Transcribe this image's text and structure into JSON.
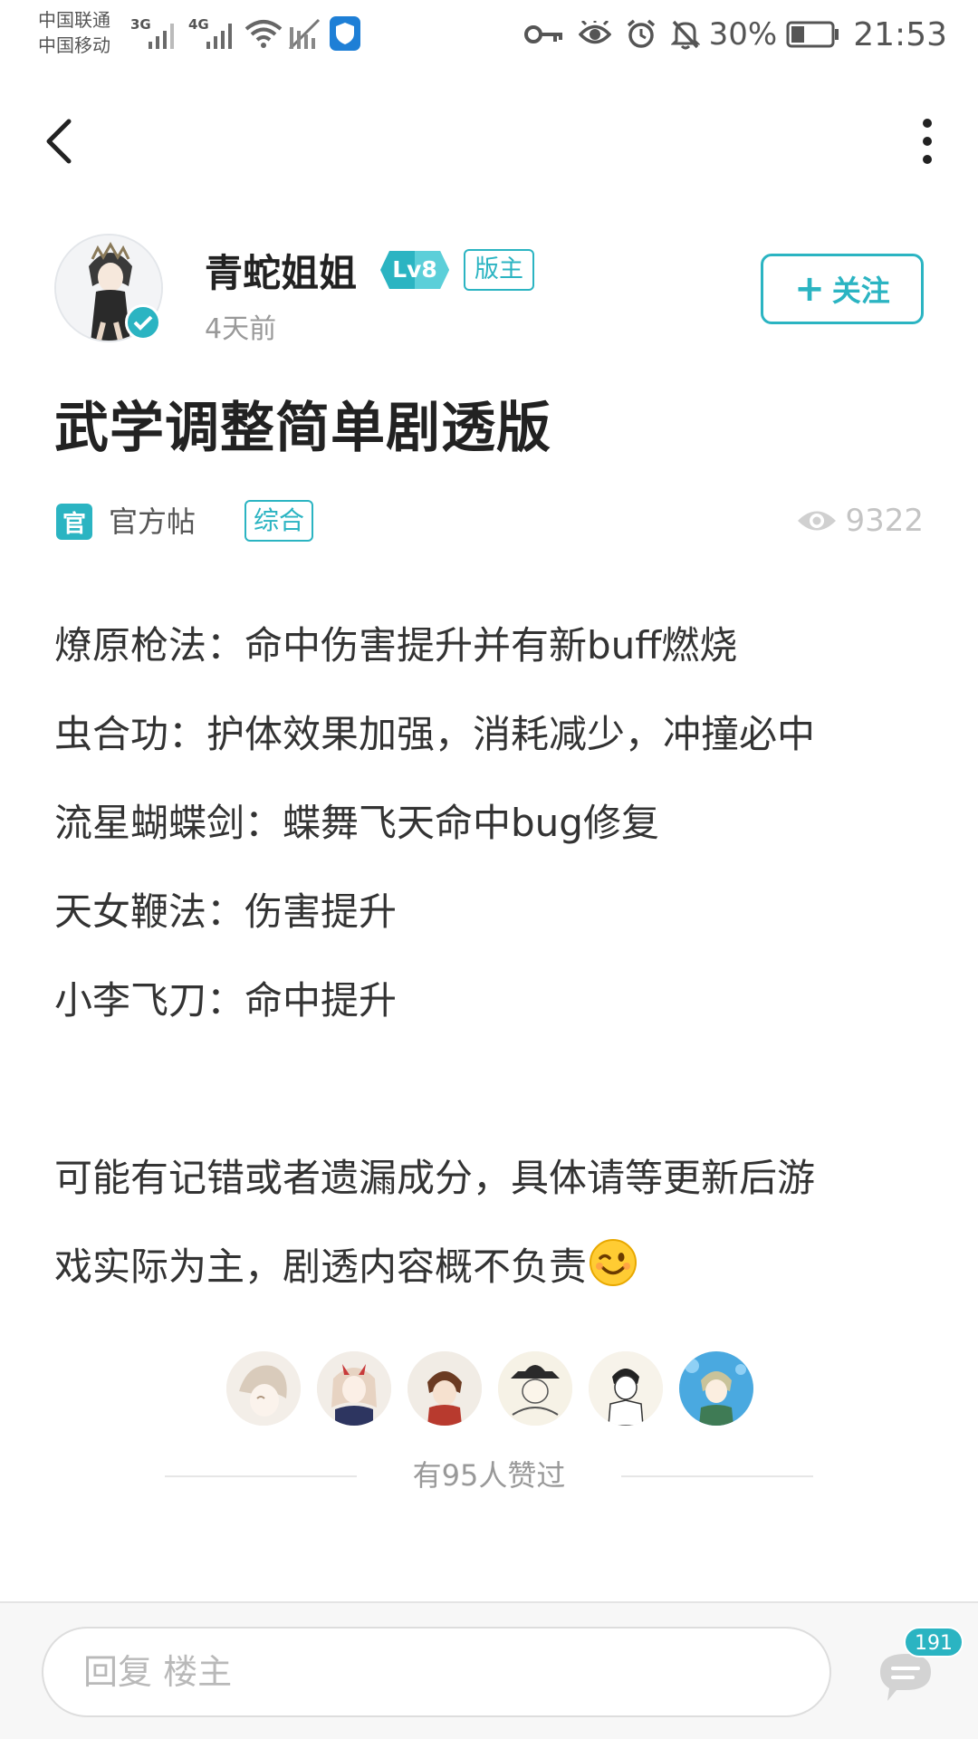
{
  "status_bar": {
    "carrier_1": "中国联通",
    "carrier_2": "中国移动",
    "network_1": "3G",
    "network_2": "4G",
    "battery": "30%",
    "time": "21:53",
    "icons": [
      "key-icon",
      "eye-icon",
      "alarm-icon",
      "mute-icon",
      "battery-icon",
      "wifi-icon",
      "shield-app-icon"
    ]
  },
  "nav": {
    "back_icon": "chevron-left-icon",
    "more_icon": "more-vertical-icon"
  },
  "author": {
    "name": "青蛇姐姐",
    "level": "Lv8",
    "role": "版主",
    "time": "4天前",
    "verified": true,
    "follow_label": "关注"
  },
  "post": {
    "title": "武学调整简单剧透版",
    "official_icon": "官",
    "official_label": "官方帖",
    "category": "综合",
    "views": "9322",
    "lines": [
      "燎原枪法：命中伤害提升并有新buff燃烧",
      "虫合功：护体效果加强，消耗减少，冲撞必中",
      "流星蝴蝶剑：蝶舞飞天命中bug修复",
      "天女鞭法：伤害提升",
      "小李飞刀：命中提升"
    ],
    "note_1": "可能有记错或者遗漏成分，具体请等更新后游",
    "note_2": "戏实际为主，剧透内容概不负责",
    "note_emoji": "wink-emoji-icon"
  },
  "likes": {
    "avatar_count": 6,
    "label": "有95人赞过"
  },
  "reply": {
    "placeholder": "回复  楼主",
    "comment_count": "191"
  },
  "colors": {
    "accent": "#2bb4c2",
    "text_primary": "#222222",
    "text_body": "#333333",
    "text_muted": "#999999",
    "bottom_bar": "#f7f7f7"
  }
}
